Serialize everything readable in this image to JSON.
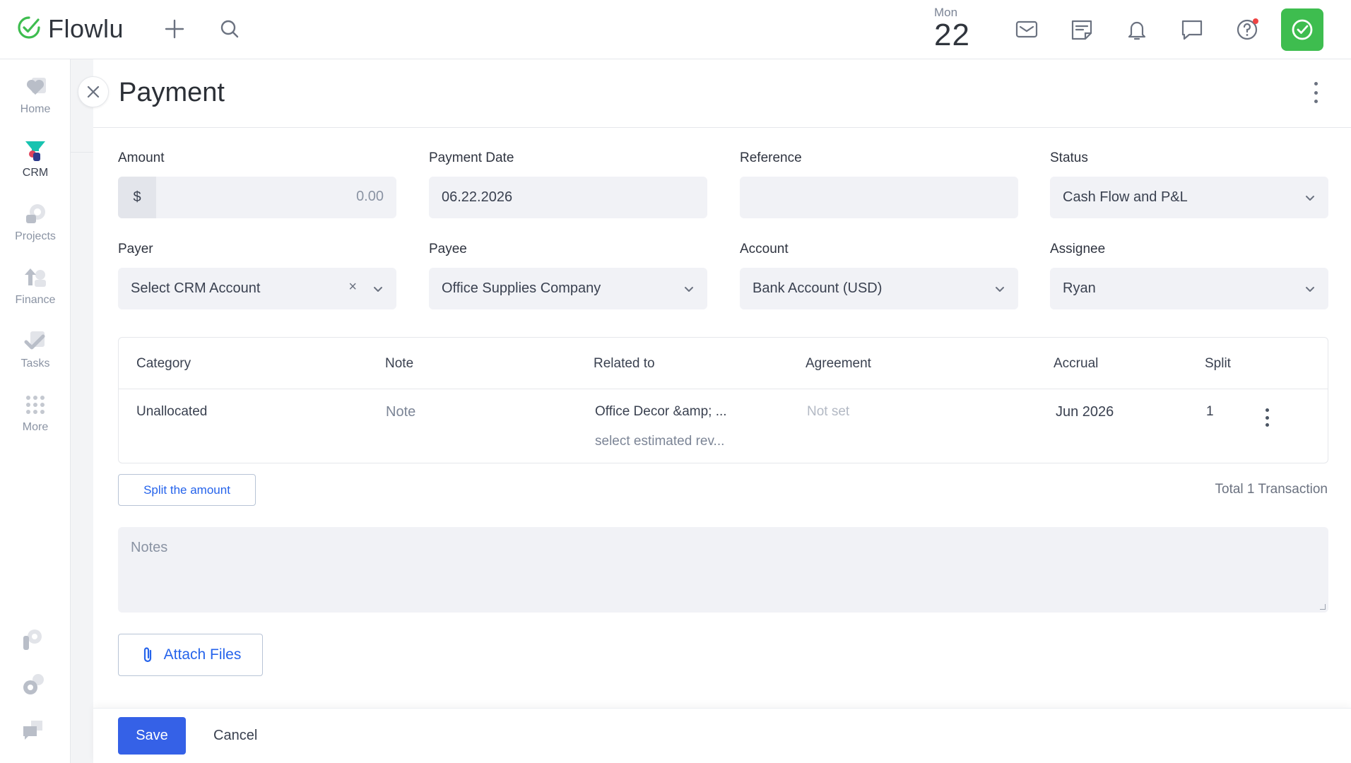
{
  "app": {
    "name": "Flowlu"
  },
  "topbar": {
    "date_dow": "Mon",
    "date_day": "22",
    "icons": [
      "plus-icon",
      "search-icon",
      "mail-icon",
      "notes-icon",
      "bell-icon",
      "chat-icon",
      "help-icon",
      "check-icon"
    ]
  },
  "sidebar": {
    "items": [
      {
        "label": "Home",
        "icon": "heart-icon"
      },
      {
        "label": "CRM",
        "icon": "funnel-icon"
      },
      {
        "label": "Projects",
        "icon": "projects-icon"
      },
      {
        "label": "Finance",
        "icon": "finance-icon"
      },
      {
        "label": "Tasks",
        "icon": "tasks-icon"
      },
      {
        "label": "More",
        "icon": "grid-icon"
      }
    ],
    "bottom_icons": [
      "flowlu-p-icon",
      "settings-icon",
      "feedback-icon"
    ]
  },
  "panel": {
    "title": "Payment"
  },
  "form": {
    "amount_label": "Amount",
    "amount_prefix": "$",
    "amount_value": "0.00",
    "payment_date_label": "Payment Date",
    "payment_date_value": "06.22.2026",
    "reference_label": "Reference",
    "reference_value": "",
    "status_label": "Status",
    "status_value": "Cash Flow and P&L",
    "payer_label": "Payer",
    "payer_value": "Select CRM Account",
    "payer_clear": "×",
    "payee_label": "Payee",
    "payee_value": "Office Supplies Company",
    "account_label": "Account",
    "account_value": "Bank Account (USD)",
    "assignee_label": "Assignee",
    "assignee_value": "Ryan"
  },
  "transactions": {
    "columns": [
      "Category",
      "Note",
      "Related to",
      "Agreement",
      "Accrual",
      "Split"
    ],
    "rows": [
      {
        "category": "Unallocated",
        "note": "Note",
        "related_to": "Office Decor &amp; ...",
        "related_sub": "select estimated rev...",
        "agreement": "Not set",
        "accrual": "Jun 2026",
        "split": "1"
      }
    ],
    "split_button": "Split the amount",
    "total": "Total 1 Transaction"
  },
  "notes": {
    "placeholder": "Notes"
  },
  "attach": {
    "label": "Attach Files"
  },
  "footer": {
    "save": "Save",
    "cancel": "Cancel"
  },
  "colors": {
    "brand_green": "#3ebd4f",
    "primary_blue": "#3561e7",
    "link_blue": "#2563eb",
    "field_bg": "#f1f2f6"
  }
}
